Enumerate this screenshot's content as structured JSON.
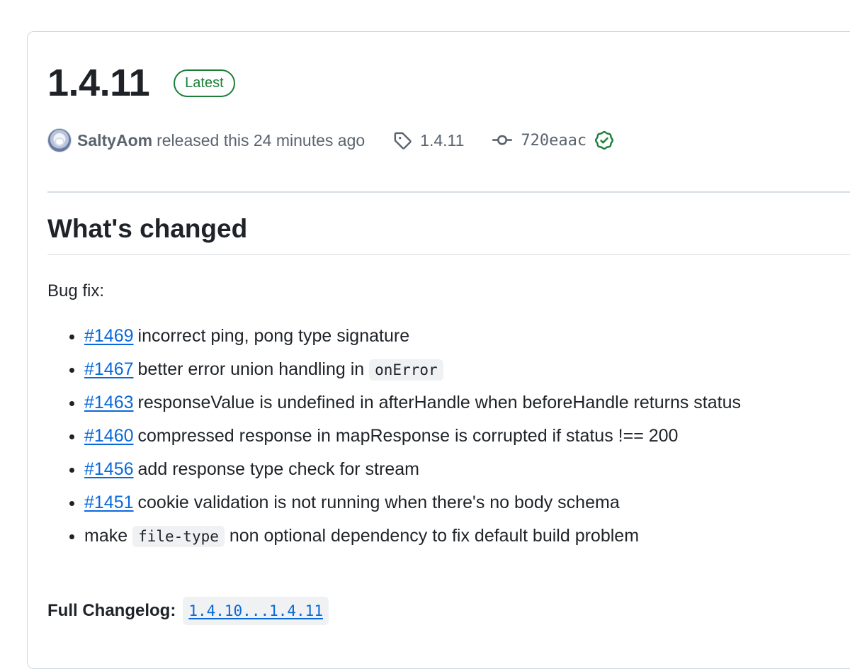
{
  "release": {
    "title": "1.4.11",
    "badge": "Latest",
    "author": "SaltyAom",
    "released_text": "released this 24 minutes ago",
    "tag": "1.4.11",
    "commit": "720eaac"
  },
  "body": {
    "heading": "What's changed",
    "intro": "Bug fix:",
    "items": [
      {
        "link": "#1469",
        "text": "incorrect ping, pong type signature"
      },
      {
        "link": "#1467",
        "text": "better error union handling in ",
        "code": "onError"
      },
      {
        "link": "#1463",
        "text": "responseValue is undefined in afterHandle when beforeHandle returns status"
      },
      {
        "link": "#1460",
        "text": "compressed response in mapResponse is corrupted if status !== 200"
      },
      {
        "link": "#1456",
        "text": "add response type check for stream"
      },
      {
        "link": "#1451",
        "text": "cookie validation is not running when there's no body schema"
      },
      {
        "pre": "make ",
        "code": "file-type",
        "post": " non optional dependency to fix default build problem"
      }
    ],
    "changelog_label": "Full Changelog:",
    "changelog_link": "1.4.10...1.4.11"
  },
  "colors": {
    "link": "#0969da",
    "badge_green": "#1a7f37",
    "muted_text": "#59636e",
    "code_bg": "#eff1f3",
    "border": "#d0d7de"
  },
  "icons": [
    "tag-icon",
    "git-commit-icon",
    "verified-check-icon"
  ]
}
